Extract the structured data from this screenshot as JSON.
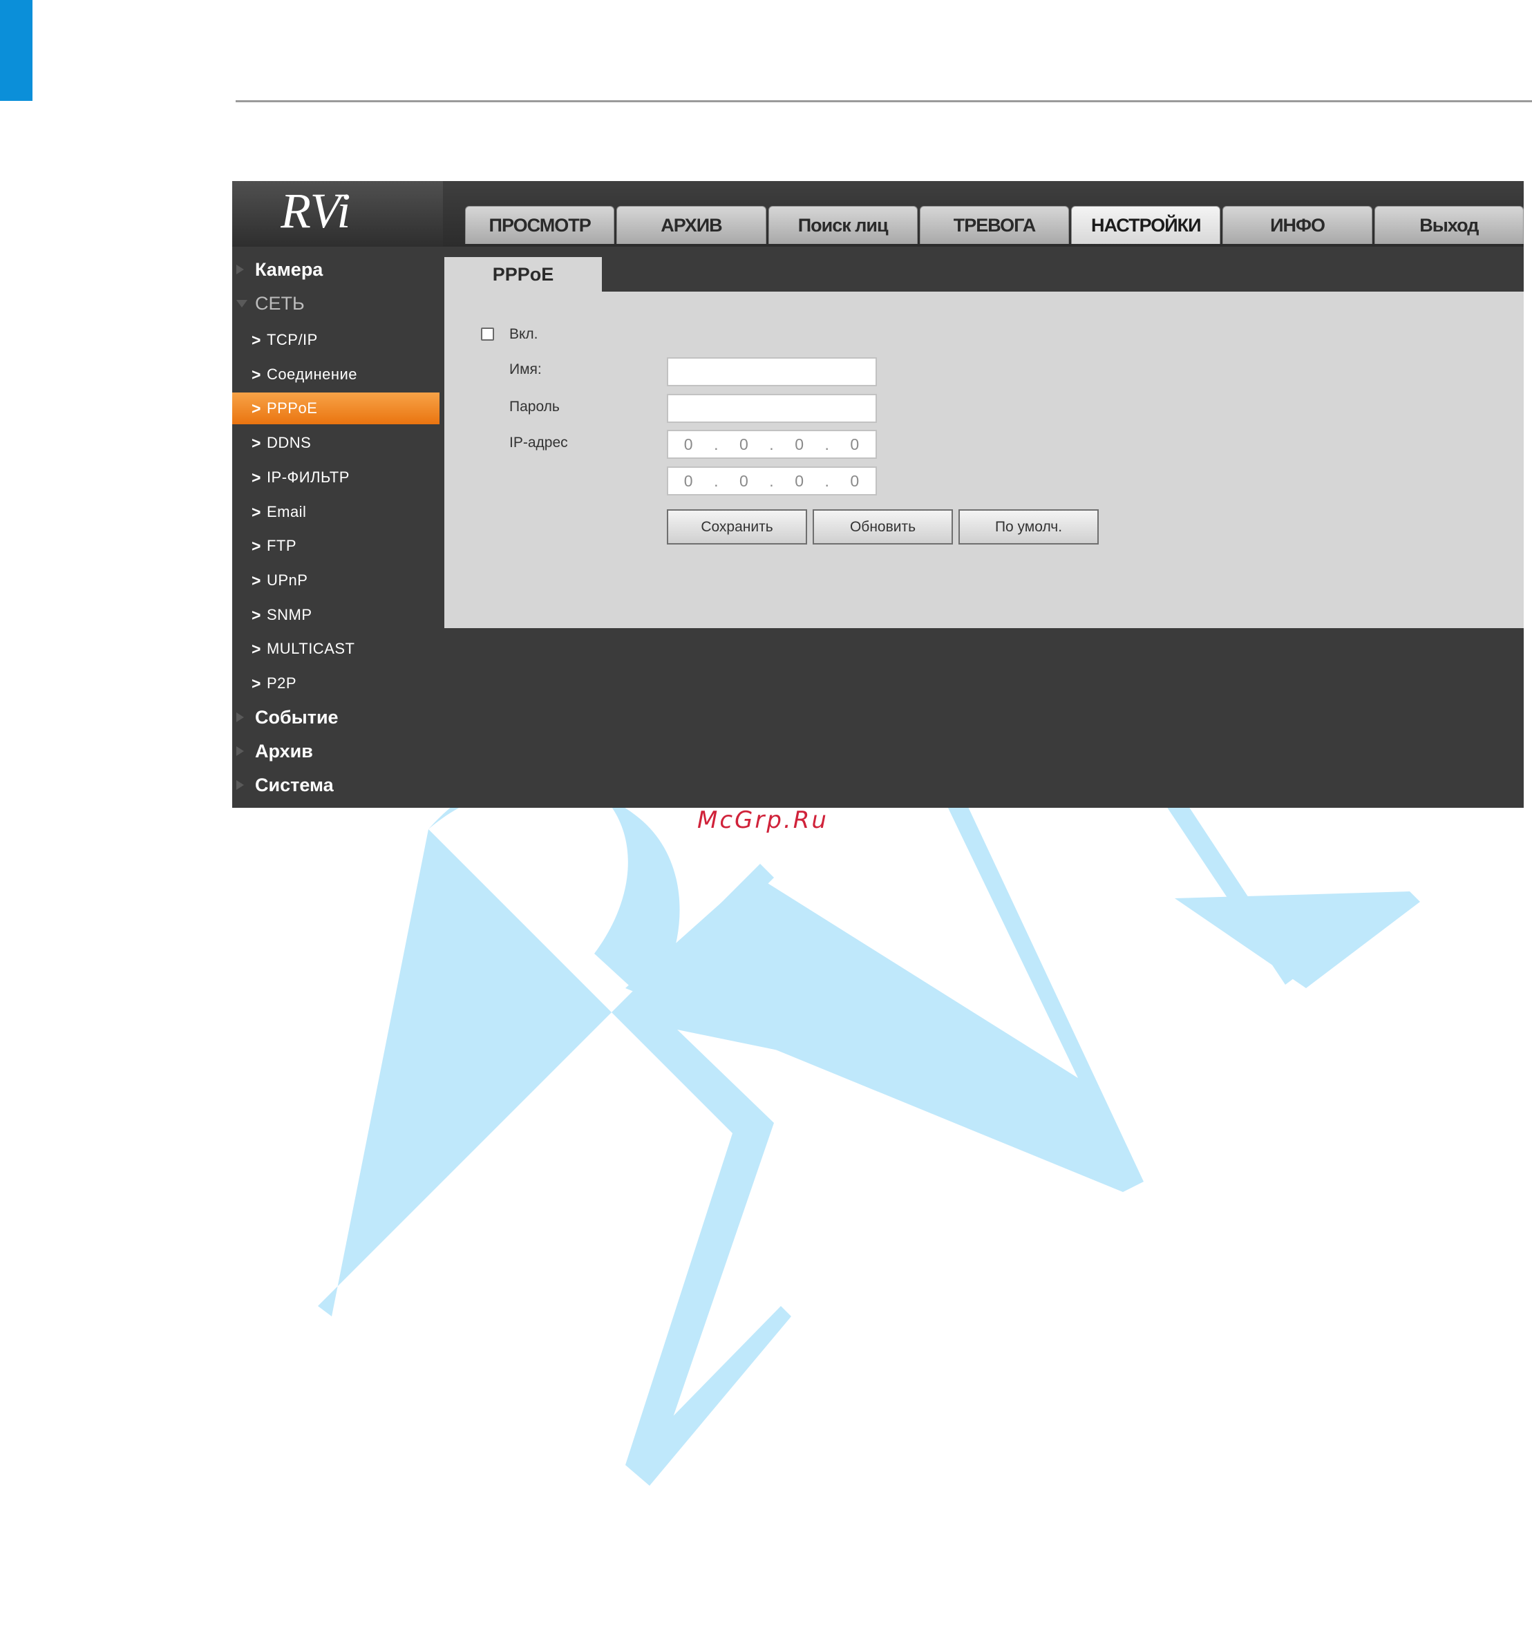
{
  "brand": {
    "logo_text": "RVi",
    "accent_color": "#0b8fd9"
  },
  "topnav": {
    "tabs": [
      {
        "label": "ПРОСМОТР"
      },
      {
        "label": "АРХИВ"
      },
      {
        "label": "Поиск лиц"
      },
      {
        "label": "ТРЕВОГА"
      },
      {
        "label": "НАСТРОЙКИ",
        "active": true
      },
      {
        "label": "ИНФО"
      },
      {
        "label": "Выход"
      }
    ]
  },
  "sidebar": {
    "groups": {
      "camera": "Камера",
      "network": "СЕТЬ",
      "event": "Событие",
      "archive": "Архив",
      "system": "Система"
    },
    "network_items": [
      "TCP/IP",
      "Соединение",
      "PPPoE",
      "DDNS",
      "IP-ФИЛЬТР",
      "Email",
      "FTP",
      "UPnP",
      "SNMP",
      "MULTICAST",
      "P2P"
    ],
    "active_item": "PPPoE",
    "active_color": "#f08a25"
  },
  "content": {
    "subtab": "PPPoE",
    "enable_label": "Вкл.",
    "enable_checked": false,
    "name_label": "Имя:",
    "name_value": "",
    "password_label": "Пароль",
    "password_value": "",
    "ip_label": "IP-адрес",
    "ip1": [
      "0",
      "0",
      "0",
      "0"
    ],
    "ip2": [
      "0",
      "0",
      "0",
      "0"
    ],
    "buttons": {
      "save": "Сохранить",
      "refresh": "Обновить",
      "default": "По умолч."
    }
  },
  "footer": {
    "site": "McGrp.Ru"
  },
  "watermark": {
    "text": "RVI",
    "color": "#bfe8fb"
  }
}
